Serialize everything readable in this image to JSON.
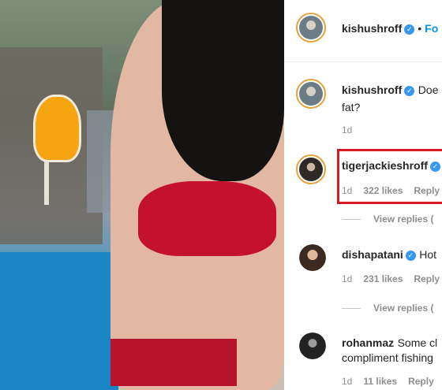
{
  "header": {
    "username": "kishushroff",
    "separator": "•",
    "follow_label": "Fo"
  },
  "verified_icon": "verified-check-icon",
  "colors": {
    "accent": "#0095f6",
    "verified": "#3897f0",
    "highlight": "#d61a22"
  },
  "comments": [
    {
      "username": "kishushroff",
      "text": "Doe",
      "text_line2": "fat?",
      "time": "1d"
    },
    {
      "username": "tigerjackieshroff",
      "time": "1d",
      "likes": "322 likes",
      "reply": "Reply",
      "view_replies": "View replies ("
    },
    {
      "username": "dishapatani",
      "text": "Hot",
      "time": "1d",
      "likes": "231 likes",
      "reply": "Reply",
      "view_replies": "View replies ("
    },
    {
      "username": "rohanmaz",
      "text": "Some cl",
      "text_line2": "compliment fishing",
      "time": "1d",
      "likes": "11 likes",
      "reply": "Reply"
    }
  ]
}
